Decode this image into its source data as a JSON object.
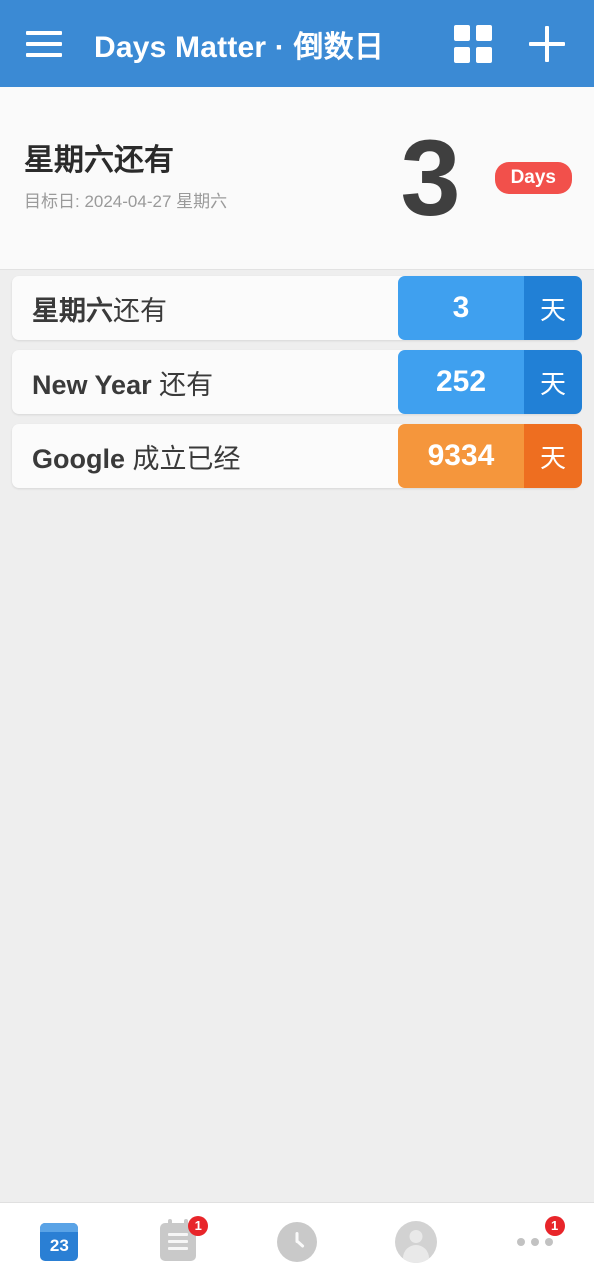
{
  "appbar": {
    "menu_icon": "hamburger-menu-icon",
    "title": "Days Matter · 倒数日",
    "grid_icon": "grid-view-icon",
    "add_icon": "plus-add-icon",
    "background_color": "#3b8ad4"
  },
  "summary": {
    "title": "星期六还有",
    "subtitle": "目标日: 2024-04-27 星期六",
    "number": "3",
    "badge": "Days",
    "badge_color": "#f2504b",
    "background_color": "#fafafa"
  },
  "events": [
    {
      "label_bold": "星期六",
      "label_rest": "还有",
      "count": "3",
      "unit": "天",
      "count_color": "#3fa0ef",
      "unit_color": "#2180d6"
    },
    {
      "label_bold": "New Year",
      "label_rest": " 还有",
      "count": "252",
      "unit": "天",
      "count_color": "#3fa0ef",
      "unit_color": "#2180d6"
    },
    {
      "label_bold": "Google",
      "label_rest": " 成立已经",
      "count": "9334",
      "unit": "天",
      "count_color": "#f5963c",
      "unit_color": "#ee6e20"
    }
  ],
  "bottomnav": {
    "items": [
      {
        "icon": "calendar-icon",
        "day": "23",
        "badge": "",
        "active": true
      },
      {
        "icon": "agenda-list-icon",
        "badge": "1",
        "active": false
      },
      {
        "icon": "clock-icon",
        "badge": "",
        "active": false
      },
      {
        "icon": "profile-avatar-icon",
        "badge": "",
        "active": false
      },
      {
        "icon": "more-dots-icon",
        "badge": "1",
        "active": false
      }
    ],
    "badge_color": "#e8252a"
  }
}
